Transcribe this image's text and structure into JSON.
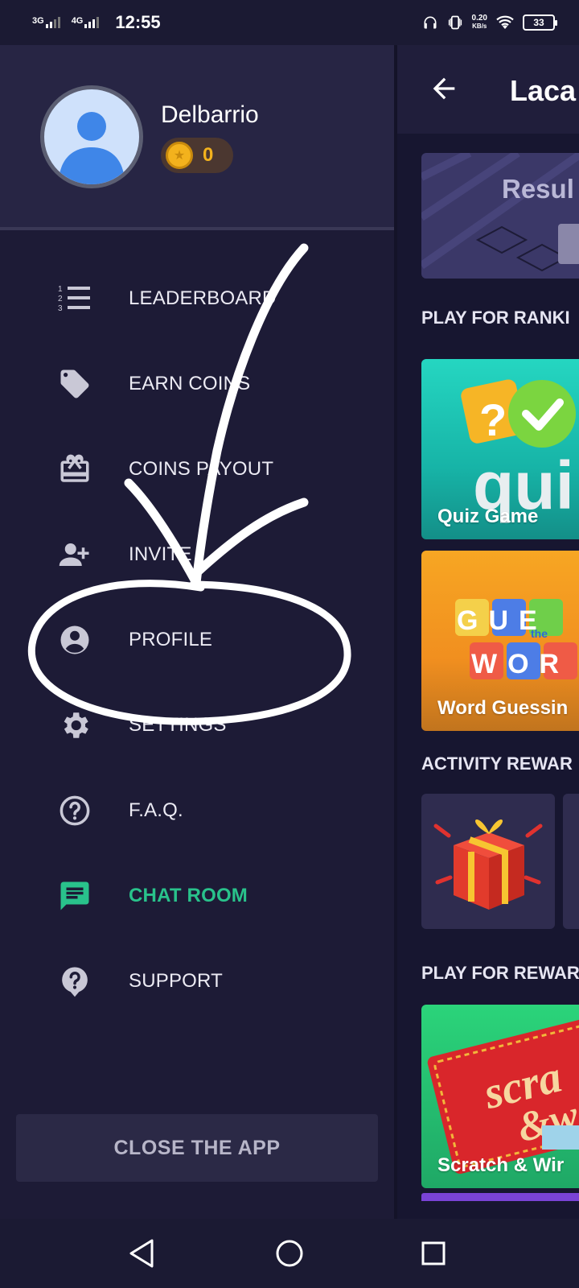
{
  "status_bar": {
    "network1": "3G",
    "network2": "4G",
    "time": "12:55",
    "speed_value": "0.20",
    "speed_unit": "KB/s",
    "battery": "33"
  },
  "drawer": {
    "user_name": "Delbarrio",
    "coins": "0",
    "items": [
      {
        "label": "LEADERBOARD",
        "icon": "leaderboard-list-icon"
      },
      {
        "label": "EARN COINS",
        "icon": "tag-icon"
      },
      {
        "label": "COINS PAYOUT",
        "icon": "gift-card-icon"
      },
      {
        "label": "INVITE",
        "icon": "person-add-icon"
      },
      {
        "label": "PROFILE",
        "icon": "account-circle-icon"
      },
      {
        "label": "SETTINGS",
        "icon": "gear-icon"
      },
      {
        "label": "F.A.Q.",
        "icon": "question-circle-icon"
      },
      {
        "label": "CHAT ROOM",
        "icon": "chat-icon"
      },
      {
        "label": "SUPPORT",
        "icon": "help-bubble-icon"
      }
    ],
    "close_button": "CLOSE THE APP"
  },
  "main": {
    "title": "Laca",
    "result_card_title": "Resul",
    "sections": {
      "ranking": "PLAY FOR RANKI",
      "activity": "ACTIVITY REWAR",
      "rewards": "PLAY FOR REWAR"
    },
    "games": {
      "quiz": "Quiz Game",
      "quiz_art": "qui",
      "word": "Word Guessin",
      "word_art_top": "GUE",
      "word_art_mid": "the",
      "word_art_bottom": "WOR",
      "scratch": "Scratch & Wir",
      "scratch_art_top": "scra",
      "scratch_art_bottom": "&w"
    }
  },
  "colors": {
    "drawer_bg": "#1d1b36",
    "header_bg": "#272544",
    "accent_green": "#29c28b",
    "coin_gold": "#f3b21d"
  }
}
